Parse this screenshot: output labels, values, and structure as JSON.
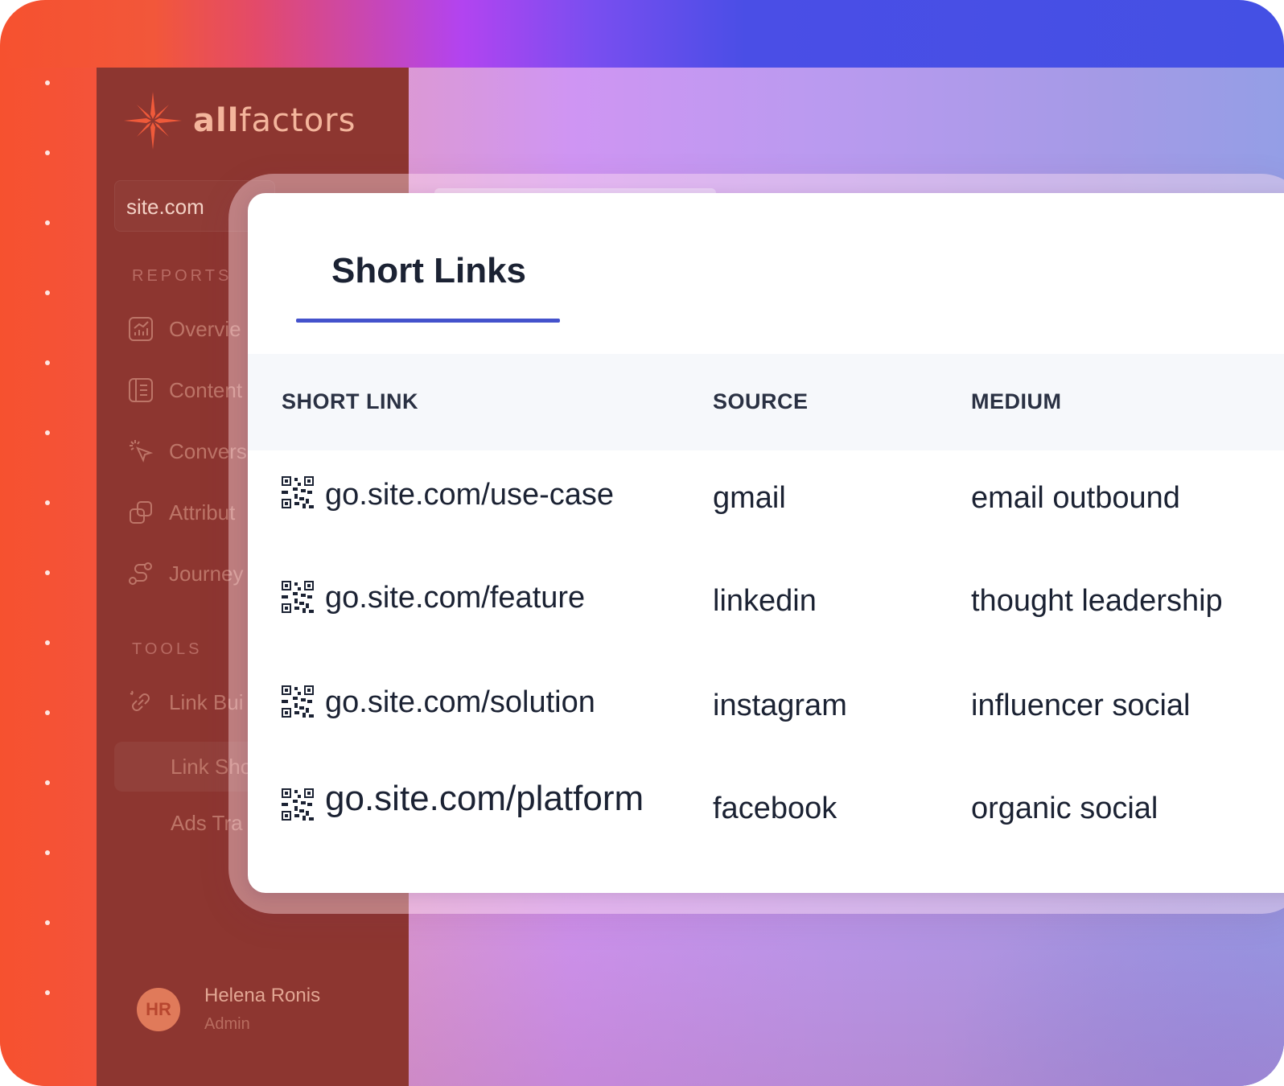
{
  "brand": {
    "name_bold": "all",
    "name_rest": "factors"
  },
  "workspace": "site.com",
  "sidebar": {
    "reports_title": "REPORTS",
    "reports": [
      {
        "label": "Overvie",
        "icon": "chart-icon"
      },
      {
        "label": "Content",
        "icon": "document-icon"
      },
      {
        "label": "Convers",
        "icon": "cursor-click-icon"
      },
      {
        "label": "Attribut",
        "icon": "copy-icon"
      },
      {
        "label": "Journey",
        "icon": "route-icon"
      }
    ],
    "tools_title": "TOOLS",
    "tools": [
      {
        "label": "Link Bui",
        "icon": "link-icon"
      },
      {
        "label": "Link Sho",
        "icon": ""
      },
      {
        "label": "Ads Tra",
        "icon": ""
      }
    ]
  },
  "user": {
    "initials": "HR",
    "name": "Helena Ronis",
    "role": "Admin"
  },
  "panel": {
    "title": "Short Links",
    "columns": [
      "SHORT LINK",
      "SOURCE",
      "MEDIUM"
    ],
    "rows": [
      {
        "link": "go.site.com/use-case",
        "source": "gmail",
        "medium": "email outbound"
      },
      {
        "link": "go.site.com/feature",
        "source": "linkedin",
        "medium": "thought leadership"
      },
      {
        "link": "go.site.com/solution",
        "source": "instagram",
        "medium": "influencer social"
      },
      {
        "link": "go.site.com/platform",
        "source": "facebook",
        "medium": "organic social"
      }
    ]
  },
  "colors": {
    "accent": "#4452cc",
    "sidebar": "#8d3630",
    "brand": "#f05a3a"
  }
}
